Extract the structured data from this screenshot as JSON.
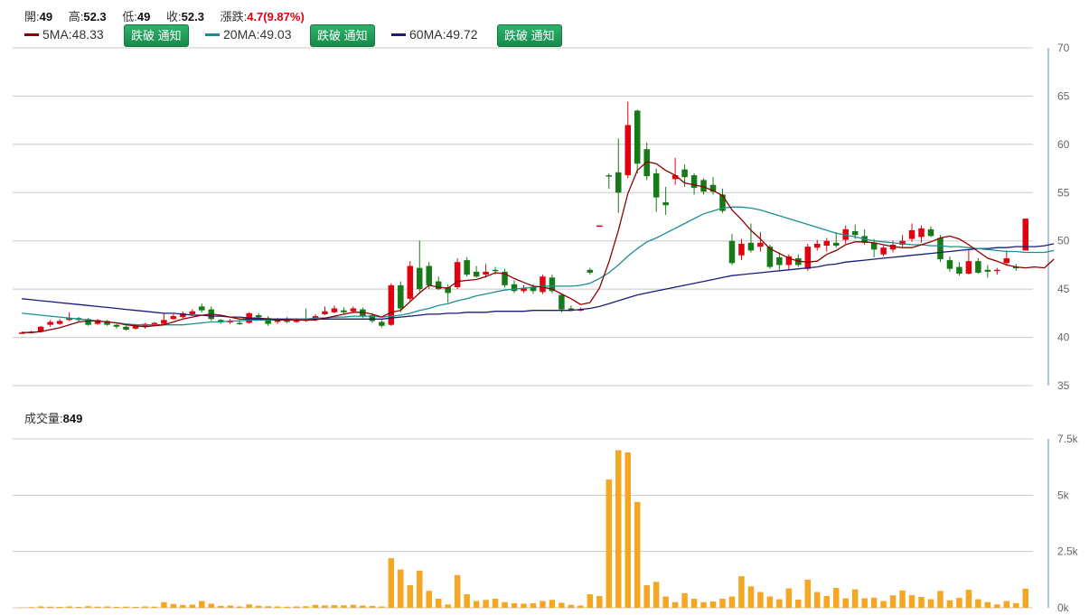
{
  "ohlc": {
    "open_label": "開:",
    "open": "49",
    "high_label": "高:",
    "high": "52.3",
    "low_label": "低:",
    "low": "49",
    "close_label": "收:",
    "close": "52.3",
    "change_label": "漲跌:",
    "change": "4.7(9.87%)"
  },
  "ma": [
    {
      "label": "5MA:48.33",
      "color": "#8b0000"
    },
    {
      "label": "20MA:49.03",
      "color": "#1a8f8f"
    },
    {
      "label": "60MA:49.72",
      "color": "#1a1a7a"
    }
  ],
  "notify_button": "跌破 通知",
  "volume": {
    "label": "成交量:",
    "value": "849"
  },
  "colors": {
    "up": "#e3000f",
    "down": "#167a16",
    "volume": "#f5a623",
    "grid": "#c8c8c8",
    "axis": "#b0c4de"
  },
  "chart_data": {
    "type": "candlestick",
    "price_axis": {
      "ticks": [
        "70",
        "65",
        "60",
        "55",
        "50",
        "45",
        "40",
        "35"
      ],
      "ylim": [
        35,
        70
      ]
    },
    "volume_axis": {
      "ticks": [
        "7.5k",
        "5k",
        "2.5k",
        "0k"
      ],
      "ylim": [
        0,
        7500
      ]
    },
    "candles": [
      [
        40.5,
        40.5,
        40.6,
        40.4,
        20
      ],
      [
        40.5,
        40.6,
        40.7,
        40.4,
        30
      ],
      [
        40.6,
        41.1,
        41.2,
        40.5,
        60
      ],
      [
        41.3,
        41.6,
        41.8,
        41.1,
        50
      ],
      [
        41.4,
        41.7,
        41.9,
        41.3,
        40
      ],
      [
        41.8,
        42.0,
        42.6,
        41.7,
        60
      ],
      [
        42.0,
        41.8,
        42.1,
        41.6,
        40
      ],
      [
        41.9,
        41.3,
        42.0,
        41.2,
        70
      ],
      [
        41.4,
        41.8,
        41.9,
        41.3,
        50
      ],
      [
        41.7,
        41.3,
        41.8,
        41.2,
        60
      ],
      [
        41.3,
        41.1,
        41.4,
        40.9,
        40
      ],
      [
        41.1,
        40.8,
        41.2,
        40.7,
        50
      ],
      [
        40.9,
        41.2,
        41.4,
        40.8,
        40
      ],
      [
        41.1,
        41.4,
        41.5,
        40.9,
        60
      ],
      [
        41.3,
        41.5,
        41.6,
        41.2,
        50
      ],
      [
        41.4,
        41.8,
        42.5,
        41.3,
        250
      ],
      [
        41.9,
        42.2,
        42.4,
        41.8,
        170
      ],
      [
        42.1,
        42.5,
        42.7,
        42.0,
        120
      ],
      [
        42.4,
        42.7,
        42.9,
        42.3,
        140
      ],
      [
        43.2,
        42.8,
        43.5,
        42.6,
        300
      ],
      [
        42.9,
        41.9,
        43.2,
        41.7,
        180
      ],
      [
        41.8,
        41.6,
        41.9,
        41.4,
        80
      ],
      [
        41.6,
        41.7,
        41.9,
        41.4,
        100
      ],
      [
        41.5,
        41.4,
        41.8,
        41.3,
        60
      ],
      [
        41.5,
        42.5,
        42.6,
        41.4,
        150
      ],
      [
        42.3,
        42.1,
        42.5,
        42.0,
        90
      ],
      [
        42.0,
        41.4,
        42.2,
        41.2,
        70
      ],
      [
        41.6,
        41.9,
        42.0,
        41.4,
        60
      ],
      [
        41.8,
        41.6,
        42.1,
        41.5,
        50
      ],
      [
        41.6,
        41.9,
        42.0,
        41.5,
        60
      ],
      [
        41.9,
        41.7,
        43.0,
        41.6,
        70
      ],
      [
        41.8,
        42.2,
        42.4,
        41.7,
        130
      ],
      [
        42.4,
        42.7,
        43.2,
        42.3,
        110
      ],
      [
        42.6,
        43.0,
        43.3,
        42.5,
        120
      ],
      [
        42.8,
        42.6,
        43.1,
        42.4,
        110
      ],
      [
        42.7,
        43.0,
        43.2,
        42.5,
        130
      ],
      [
        42.9,
        42.2,
        43.1,
        42.0,
        100
      ],
      [
        42.3,
        41.7,
        42.5,
        41.5,
        80
      ],
      [
        41.6,
        41.2,
        41.8,
        41.0,
        60
      ],
      [
        41.3,
        45.4,
        45.6,
        41.2,
        2200
      ],
      [
        45.4,
        43.0,
        45.8,
        42.6,
        1700
      ],
      [
        44.0,
        47.4,
        47.9,
        43.8,
        1000
      ],
      [
        47.2,
        45.0,
        50.0,
        44.7,
        1650
      ],
      [
        47.4,
        45.4,
        47.8,
        45.0,
        750
      ],
      [
        45.8,
        45.0,
        46.3,
        44.9,
        400
      ],
      [
        45.2,
        44.6,
        45.5,
        43.6,
        150
      ],
      [
        45.2,
        47.8,
        48.2,
        45.0,
        1450
      ],
      [
        48.0,
        46.5,
        48.3,
        46.3,
        600
      ],
      [
        46.8,
        46.3,
        47.4,
        46.2,
        300
      ],
      [
        46.5,
        46.8,
        47.6,
        46.2,
        350
      ],
      [
        47.0,
        46.9,
        47.3,
        46.5,
        400
      ],
      [
        46.8,
        45.4,
        47.1,
        45.2,
        250
      ],
      [
        45.5,
        44.8,
        45.9,
        44.6,
        200
      ],
      [
        44.8,
        45.1,
        45.4,
        44.6,
        180
      ],
      [
        45.2,
        44.8,
        45.5,
        44.5,
        200
      ],
      [
        44.7,
        46.3,
        46.5,
        44.5,
        300
      ],
      [
        46.2,
        44.8,
        46.5,
        44.6,
        350
      ],
      [
        44.4,
        42.9,
        44.5,
        42.6,
        220
      ],
      [
        43.0,
        42.9,
        43.3,
        42.7,
        130
      ],
      [
        42.9,
        42.9,
        43.1,
        42.7,
        100
      ],
      [
        47.0,
        46.7,
        47.2,
        46.5,
        600
      ],
      [
        51.6,
        51.6,
        51.6,
        51.6,
        520
      ],
      [
        56.8,
        56.7,
        57.0,
        55.4,
        5700
      ],
      [
        57.1,
        55.0,
        60.6,
        52.9,
        7000
      ],
      [
        56.8,
        62.0,
        64.4,
        56.5,
        6900
      ],
      [
        63.5,
        58.0,
        63.6,
        57.0,
        4700
      ],
      [
        59.5,
        56.7,
        60.2,
        56.3,
        1000
      ],
      [
        57.0,
        54.5,
        57.5,
        53.0,
        1150
      ],
      [
        54.0,
        53.7,
        55.6,
        52.7,
        500
      ],
      [
        56.4,
        56.8,
        58.6,
        55.8,
        250
      ],
      [
        57.4,
        56.6,
        57.9,
        55.6,
        650
      ],
      [
        56.8,
        55.5,
        57.0,
        54.8,
        400
      ],
      [
        56.3,
        55.1,
        56.5,
        54.8,
        250
      ],
      [
        55.8,
        55.1,
        56.6,
        54.8,
        280
      ],
      [
        54.8,
        53.1,
        55.4,
        52.9,
        400
      ],
      [
        50.0,
        47.7,
        50.7,
        47.5,
        500
      ],
      [
        48.5,
        49.7,
        50.2,
        48.0,
        1400
      ],
      [
        49.8,
        49.0,
        51.8,
        48.8,
        950
      ],
      [
        49.4,
        49.8,
        50.9,
        48.9,
        700
      ],
      [
        49.4,
        47.3,
        49.6,
        47.1,
        500
      ],
      [
        48.3,
        47.5,
        48.8,
        47.0,
        380
      ],
      [
        47.5,
        48.4,
        48.6,
        47.0,
        860
      ],
      [
        48.2,
        47.5,
        48.6,
        47.3,
        360
      ],
      [
        47.1,
        49.4,
        49.7,
        46.9,
        1250
      ],
      [
        49.3,
        49.7,
        50.1,
        49.0,
        700
      ],
      [
        49.5,
        50.0,
        50.3,
        48.9,
        520
      ],
      [
        49.8,
        49.5,
        50.9,
        49.3,
        880
      ],
      [
        50.1,
        51.2,
        51.6,
        49.7,
        420
      ],
      [
        51.0,
        50.6,
        51.7,
        50.2,
        820
      ],
      [
        50.5,
        49.8,
        51.2,
        49.6,
        420
      ],
      [
        49.8,
        49.1,
        50.2,
        48.3,
        450
      ],
      [
        48.6,
        49.3,
        49.5,
        48.4,
        300
      ],
      [
        49.1,
        49.6,
        50.0,
        48.8,
        550
      ],
      [
        49.6,
        50.0,
        50.6,
        49.4,
        770
      ],
      [
        50.2,
        51.1,
        51.8,
        49.9,
        560
      ],
      [
        50.4,
        51.3,
        51.6,
        49.8,
        480
      ],
      [
        51.2,
        50.5,
        51.5,
        50.4,
        380
      ],
      [
        50.3,
        48.1,
        50.6,
        47.8,
        750
      ],
      [
        48.0,
        47.1,
        48.4,
        46.8,
        330
      ],
      [
        47.3,
        46.6,
        47.8,
        46.4,
        440
      ],
      [
        46.6,
        47.9,
        49.1,
        46.5,
        800
      ],
      [
        47.9,
        46.7,
        48.2,
        46.6,
        380
      ],
      [
        47.0,
        46.8,
        47.5,
        46.2,
        250
      ],
      [
        46.9,
        47.0,
        47.2,
        46.5,
        150
      ],
      [
        47.7,
        48.2,
        49.0,
        47.5,
        300
      ],
      [
        47.3,
        47.2,
        47.6,
        46.9,
        200
      ],
      [
        49.0,
        52.3,
        52.3,
        49.0,
        849
      ]
    ],
    "ma5": [
      40.5,
      40.5,
      40.6,
      40.8,
      41.0,
      41.3,
      41.6,
      41.7,
      41.7,
      41.6,
      41.5,
      41.3,
      41.2,
      41.1,
      41.2,
      41.3,
      41.6,
      41.9,
      42.1,
      42.3,
      42.4,
      42.3,
      42.1,
      41.9,
      41.9,
      41.9,
      41.9,
      41.8,
      41.8,
      41.8,
      41.8,
      41.8,
      42.0,
      42.2,
      42.4,
      42.6,
      42.6,
      42.4,
      42.1,
      42.6,
      42.8,
      43.7,
      44.6,
      45.4,
      45.2,
      45.1,
      45.8,
      45.9,
      46.0,
      46.3,
      46.7,
      46.6,
      46.1,
      45.7,
      45.3,
      45.2,
      45.0,
      44.5,
      44.0,
      43.4,
      43.6,
      45.1,
      47.8,
      51.1,
      54.9,
      57.3,
      58.2,
      58.0,
      57.3,
      56.8,
      56.0,
      55.8,
      55.6,
      55.2,
      54.7,
      53.2,
      52.2,
      51.1,
      50.2,
      49.2,
      48.7,
      48.2,
      47.9,
      47.8,
      47.9,
      48.6,
      49.0,
      49.6,
      49.9,
      49.9,
      49.8,
      49.6,
      49.4,
      49.3,
      49.3,
      49.6,
      49.9,
      50.3,
      50.5,
      50.2,
      49.6,
      48.9,
      48.2,
      47.9,
      47.5,
      47.3,
      47.2,
      47.3,
      47.2,
      48.1
    ],
    "ma20": [
      42.5,
      42.4,
      42.3,
      42.2,
      42.1,
      42.0,
      41.9,
      41.8,
      41.7,
      41.6,
      41.5,
      41.4,
      41.3,
      41.3,
      41.3,
      41.3,
      41.3,
      41.3,
      41.4,
      41.5,
      41.6,
      41.6,
      41.7,
      41.7,
      41.8,
      41.8,
      41.8,
      41.8,
      41.8,
      41.9,
      41.9,
      42.0,
      42.0,
      42.1,
      42.1,
      42.2,
      42.2,
      42.2,
      42.1,
      42.2,
      42.3,
      42.5,
      42.8,
      43.0,
      43.3,
      43.5,
      43.8,
      44.0,
      44.3,
      44.5,
      44.7,
      44.9,
      45.0,
      45.1,
      45.2,
      45.3,
      45.3,
      45.3,
      45.3,
      45.4,
      45.6,
      46.1,
      46.7,
      47.5,
      48.4,
      49.2,
      49.9,
      50.3,
      50.8,
      51.3,
      51.8,
      52.3,
      52.8,
      53.1,
      53.4,
      53.5,
      53.5,
      53.4,
      53.2,
      52.9,
      52.6,
      52.3,
      52.0,
      51.7,
      51.4,
      51.1,
      50.8,
      50.6,
      50.4,
      50.2,
      50.0,
      49.9,
      49.8,
      49.7,
      49.6,
      49.6,
      49.5,
      49.5,
      49.4,
      49.4,
      49.3,
      49.2,
      49.1,
      49.0,
      48.9,
      48.9,
      48.8,
      48.8,
      48.8,
      49.0
    ],
    "ma60": [
      44.0,
      43.9,
      43.8,
      43.7,
      43.6,
      43.5,
      43.4,
      43.3,
      43.2,
      43.1,
      43.0,
      42.9,
      42.8,
      42.7,
      42.6,
      42.5,
      42.5,
      42.4,
      42.3,
      42.3,
      42.2,
      42.2,
      42.1,
      42.1,
      42.0,
      42.0,
      41.9,
      41.9,
      41.9,
      41.9,
      41.9,
      41.9,
      41.9,
      41.9,
      41.9,
      41.9,
      41.9,
      41.9,
      41.9,
      42.0,
      42.1,
      42.2,
      42.3,
      42.4,
      42.4,
      42.5,
      42.5,
      42.6,
      42.6,
      42.6,
      42.7,
      42.7,
      42.7,
      42.7,
      42.8,
      42.8,
      42.8,
      42.8,
      42.8,
      42.9,
      43.0,
      43.2,
      43.5,
      43.8,
      44.1,
      44.4,
      44.6,
      44.8,
      45.0,
      45.2,
      45.4,
      45.6,
      45.8,
      46.0,
      46.2,
      46.4,
      46.5,
      46.6,
      46.7,
      46.8,
      46.9,
      47.0,
      47.1,
      47.2,
      47.3,
      47.5,
      47.6,
      47.8,
      47.9,
      48.0,
      48.1,
      48.2,
      48.3,
      48.4,
      48.5,
      48.6,
      48.7,
      48.8,
      48.9,
      49.0,
      49.1,
      49.2,
      49.2,
      49.3,
      49.3,
      49.4,
      49.4,
      49.4,
      49.5,
      49.7
    ]
  }
}
